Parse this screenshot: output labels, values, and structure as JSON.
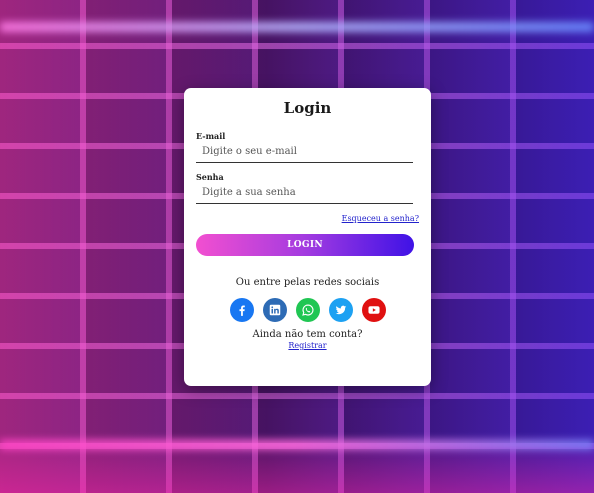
{
  "login": {
    "title": "Login",
    "email_label": "E-mail",
    "email_placeholder": "Digite o seu e-mail",
    "password_label": "Senha",
    "password_placeholder": "Digite a sua senha",
    "forgot_link": "Esqueceu a senha?",
    "login_button": "LOGIN",
    "social_text": "Ou entre pelas redes sociais",
    "social_icons": [
      "facebook-icon",
      "linkedin-icon",
      "whatsapp-icon",
      "twitter-icon",
      "youtube-icon"
    ],
    "no_account_text": "Ainda não tem conta?",
    "register_link": "Registrar"
  },
  "colors": {
    "button_gradient_start": "#f24fd0",
    "button_gradient_end": "#3f12e6",
    "link": "#2222cc",
    "facebook": "#1877f2",
    "linkedin": "#2d6bb5",
    "whatsapp": "#20c653",
    "twitter": "#1da1f2",
    "youtube": "#e01010"
  }
}
